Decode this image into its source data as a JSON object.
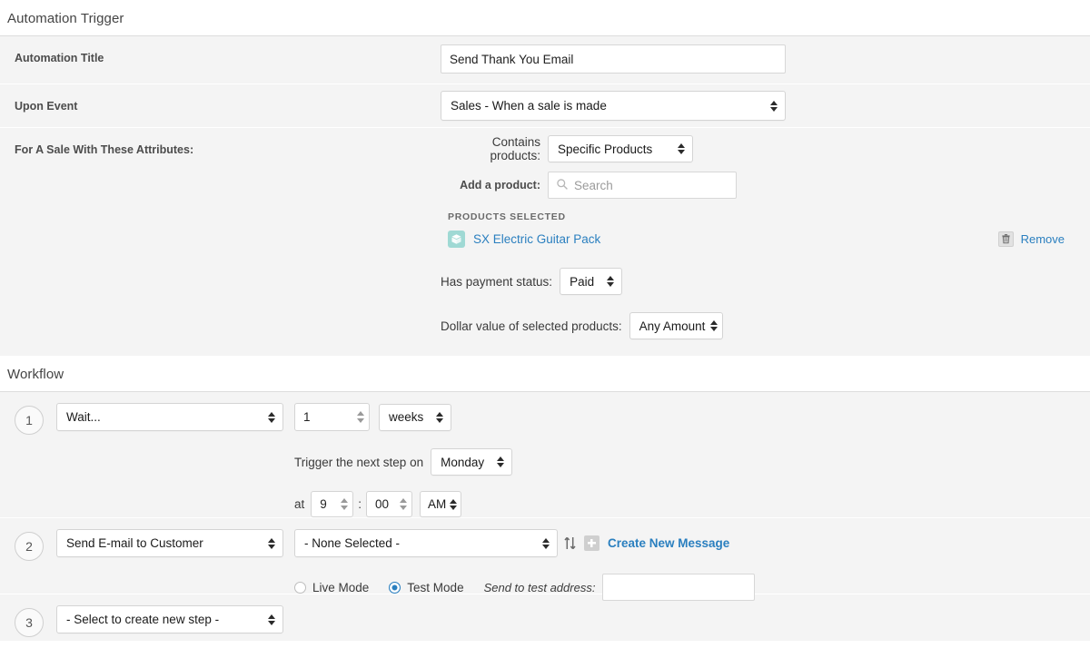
{
  "trigger": {
    "section_title": "Automation Trigger",
    "rows": [
      {
        "label": "Automation Title"
      },
      {
        "label": "Upon Event"
      },
      {
        "label": "For A Sale With These Attributes:"
      }
    ],
    "title_value": "Send Thank You Email",
    "title_placeholder": "",
    "event_value": "Sales - When a sale is made",
    "contains_label": "Contains products:",
    "contains_value": "Specific Products",
    "add_product_label": "Add a product:",
    "search_placeholder": "Search",
    "search_value": "",
    "search_icon": "search-icon",
    "products_selected_label": "PRODUCTS SELECTED",
    "product": {
      "icon": "product-box-icon",
      "name": "SX Electric Guitar Pack",
      "remove_label": "Remove",
      "remove_icon": "trash-icon"
    },
    "payment_label": "Has payment status:",
    "payment_value": "Paid",
    "dollar_label": "Dollar value of selected products:",
    "dollar_value": "Any Amount"
  },
  "workflow": {
    "section_title": "Workflow",
    "steps": [
      {
        "number": "1",
        "type": "Wait...",
        "amount": "1",
        "unit": "weeks",
        "trigger_on_label": "Trigger the next step on",
        "trigger_on_value": "Monday",
        "at_label": "at",
        "hour": "9",
        "colon": ":",
        "minute": "00",
        "meridiem": "AM"
      },
      {
        "number": "2",
        "type": "Send E-mail to Customer",
        "message": "- None Selected -",
        "swap_icon": "sort-swap-icon",
        "plus_icon": "plus-icon",
        "create_label": "Create New Message",
        "live_mode_label": "Live Mode",
        "test_mode_label": "Test Mode",
        "selected_mode": "test",
        "test_address_label": "Send to test address:",
        "test_address_value": ""
      },
      {
        "number": "3",
        "type": "- Select to create new step -"
      }
    ]
  },
  "colors": {
    "link": "#2a7fbf",
    "panel_bg": "#f4f4f4",
    "product_icon_bg": "#9fd9d4",
    "radio_on": "#2a7fbf"
  }
}
